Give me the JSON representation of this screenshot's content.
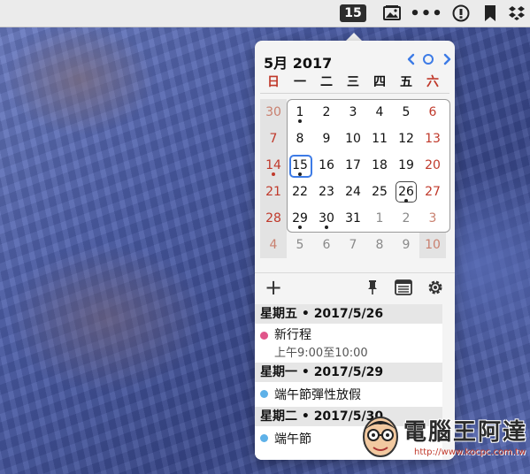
{
  "menubar": {
    "date_badge": "15",
    "more_label": "•••",
    "icons": [
      "photo-icon",
      "more-icon",
      "info-icon",
      "bookmark-icon",
      "dropbox-icon"
    ]
  },
  "calendar": {
    "title": "5月 2017",
    "weekdays": [
      "日",
      "一",
      "二",
      "三",
      "四",
      "五",
      "六"
    ],
    "weeks": [
      [
        "30",
        "1",
        "2",
        "3",
        "4",
        "5",
        "6"
      ],
      [
        "7",
        "8",
        "9",
        "10",
        "11",
        "12",
        "13"
      ],
      [
        "14",
        "15",
        "16",
        "17",
        "18",
        "19",
        "20"
      ],
      [
        "21",
        "22",
        "23",
        "24",
        "25",
        "26",
        "27"
      ],
      [
        "28",
        "29",
        "30",
        "31",
        "1",
        "2",
        "3"
      ],
      [
        "4",
        "5",
        "6",
        "7",
        "8",
        "9",
        "10"
      ]
    ],
    "today": "15",
    "selected": "26",
    "colors": {
      "accent": "#3d7be6",
      "weekend": "#c0392b"
    }
  },
  "toolbar": {
    "add_label": "+"
  },
  "events": [
    {
      "header": "星期五 • 2017/5/26",
      "items": [
        {
          "title": "新行程",
          "time": "上午9:00至10:00",
          "color": "#e0558a"
        }
      ]
    },
    {
      "header": "星期一 • 2017/5/29",
      "items": [
        {
          "title": "端午節彈性放假",
          "color": "#5eb1e8"
        }
      ]
    },
    {
      "header": "星期二 • 2017/5/30",
      "items": [
        {
          "title": "端午節",
          "color": "#5eb1e8"
        }
      ]
    }
  ],
  "watermark": {
    "title": "電腦王阿達",
    "url": "http://www.kocpc.com.tw"
  }
}
